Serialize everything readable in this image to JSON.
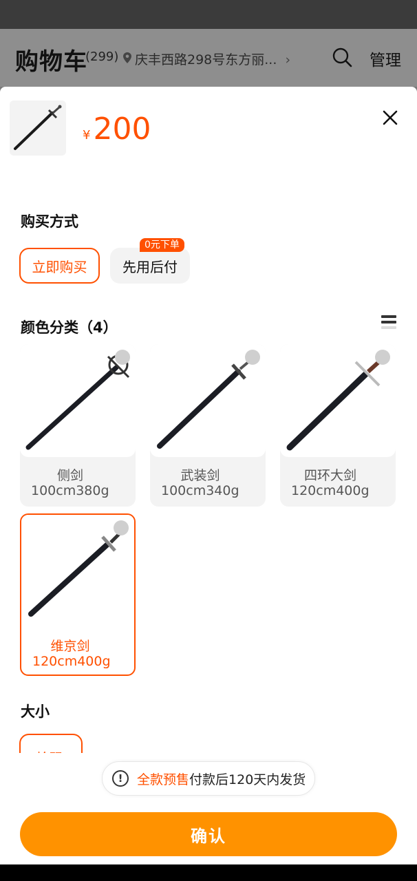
{
  "header": {
    "title": "购物车",
    "count": "(299)",
    "location": "庆丰西路298号东方丽...",
    "manage_label": "管理"
  },
  "product": {
    "currency": "¥",
    "price": "200"
  },
  "purchase": {
    "title": "购买方式",
    "options": [
      "立即购买",
      "先用后付"
    ],
    "badge": "0元下单"
  },
  "colors": {
    "title": "颜色分类（4）",
    "items": [
      {
        "name": "侧剑",
        "spec": "100cm380g"
      },
      {
        "name": "武装剑",
        "spec": "100cm340g"
      },
      {
        "name": "四环大剑",
        "spec": "120cm400g"
      },
      {
        "name": "维京剑",
        "spec": "120cm400g"
      }
    ]
  },
  "size": {
    "title": "大小",
    "option": "枪码"
  },
  "notice": {
    "highlight": "全款预售",
    "text": "付款后120天内发货"
  },
  "confirm_label": "确认",
  "colors_accent": {
    "primary": "#ff5000",
    "button": "#ff9200"
  }
}
